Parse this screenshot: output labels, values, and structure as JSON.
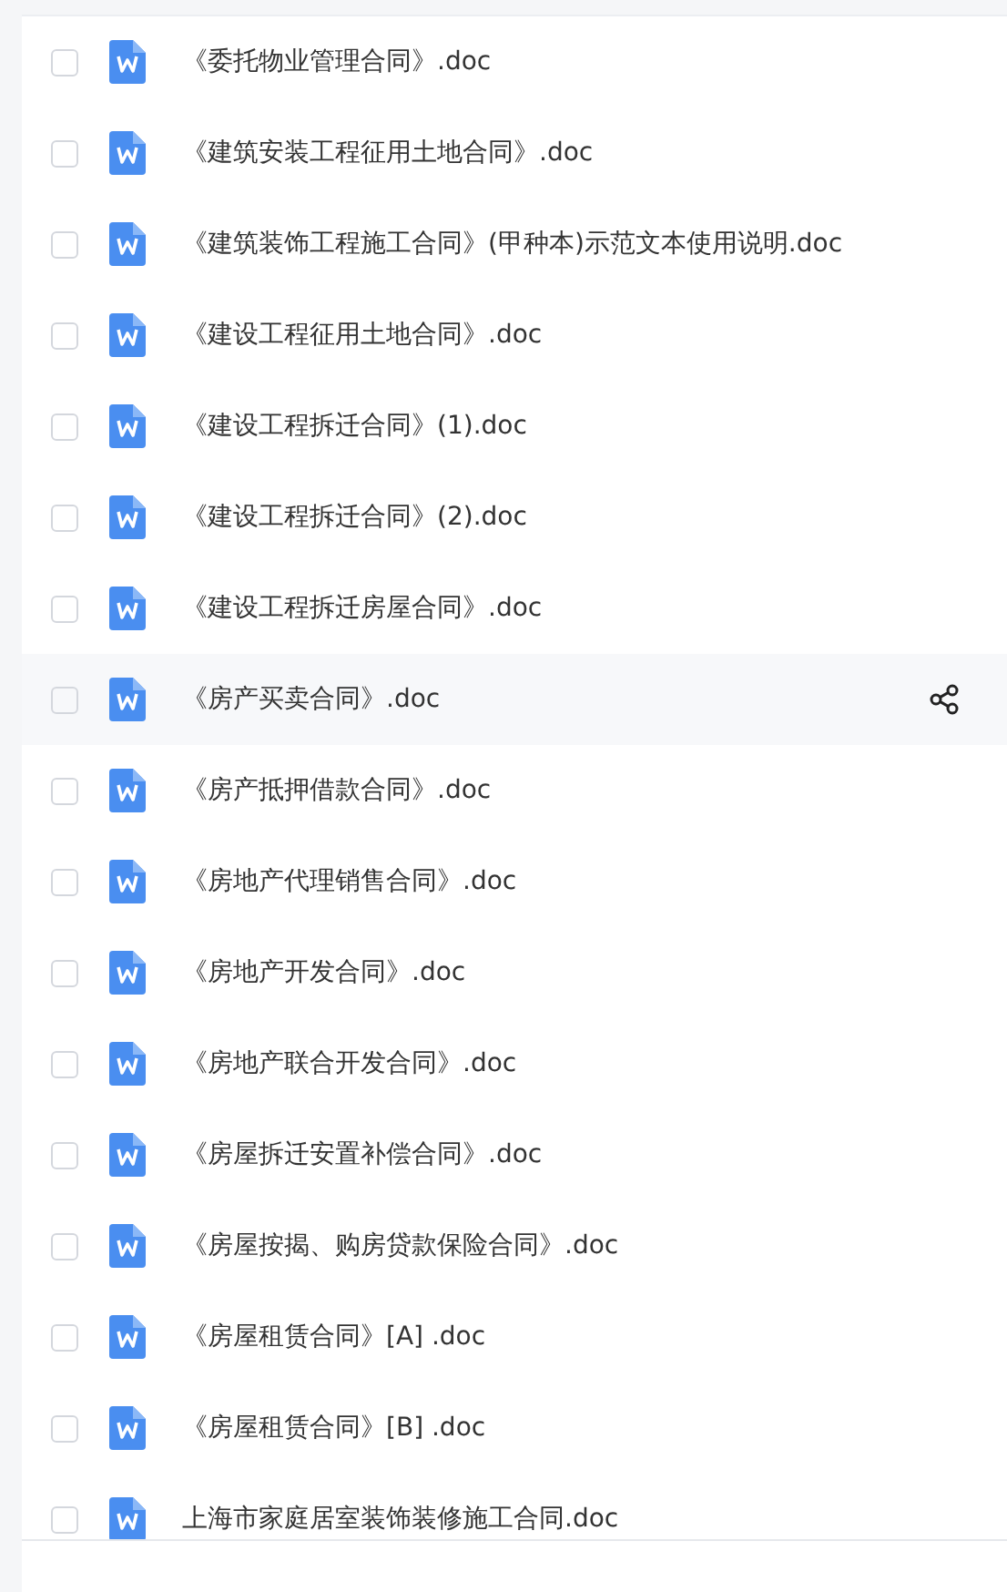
{
  "files": [
    {
      "name": "《委托物业管理合同》.doc",
      "checked": false,
      "hovered": false
    },
    {
      "name": "《建筑安装工程征用土地合同》.doc",
      "checked": false,
      "hovered": false
    },
    {
      "name": "《建筑装饰工程施工合同》(甲种本)示范文本使用说明.doc",
      "checked": false,
      "hovered": false
    },
    {
      "name": "《建设工程征用土地合同》.doc",
      "checked": false,
      "hovered": false
    },
    {
      "name": "《建设工程拆迁合同》(1).doc",
      "checked": false,
      "hovered": false
    },
    {
      "name": "《建设工程拆迁合同》(2).doc",
      "checked": false,
      "hovered": false
    },
    {
      "name": "《建设工程拆迁房屋合同》.doc",
      "checked": false,
      "hovered": false
    },
    {
      "name": "《房产买卖合同》.doc",
      "checked": false,
      "hovered": true
    },
    {
      "name": "《房产抵押借款合同》.doc",
      "checked": false,
      "hovered": false
    },
    {
      "name": "《房地产代理销售合同》.doc",
      "checked": false,
      "hovered": false
    },
    {
      "name": "《房地产开发合同》.doc",
      "checked": false,
      "hovered": false
    },
    {
      "name": "《房地产联合开发合同》.doc",
      "checked": false,
      "hovered": false
    },
    {
      "name": "《房屋拆迁安置补偿合同》.doc",
      "checked": false,
      "hovered": false
    },
    {
      "name": "《房屋按揭、购房贷款保险合同》.doc",
      "checked": false,
      "hovered": false
    },
    {
      "name": "《房屋租赁合同》[A] .doc",
      "checked": false,
      "hovered": false
    },
    {
      "name": "《房屋租赁合同》[B] .doc",
      "checked": false,
      "hovered": false
    },
    {
      "name": "上海市家庭居室装饰装修施工合同.doc",
      "checked": false,
      "hovered": false
    }
  ]
}
